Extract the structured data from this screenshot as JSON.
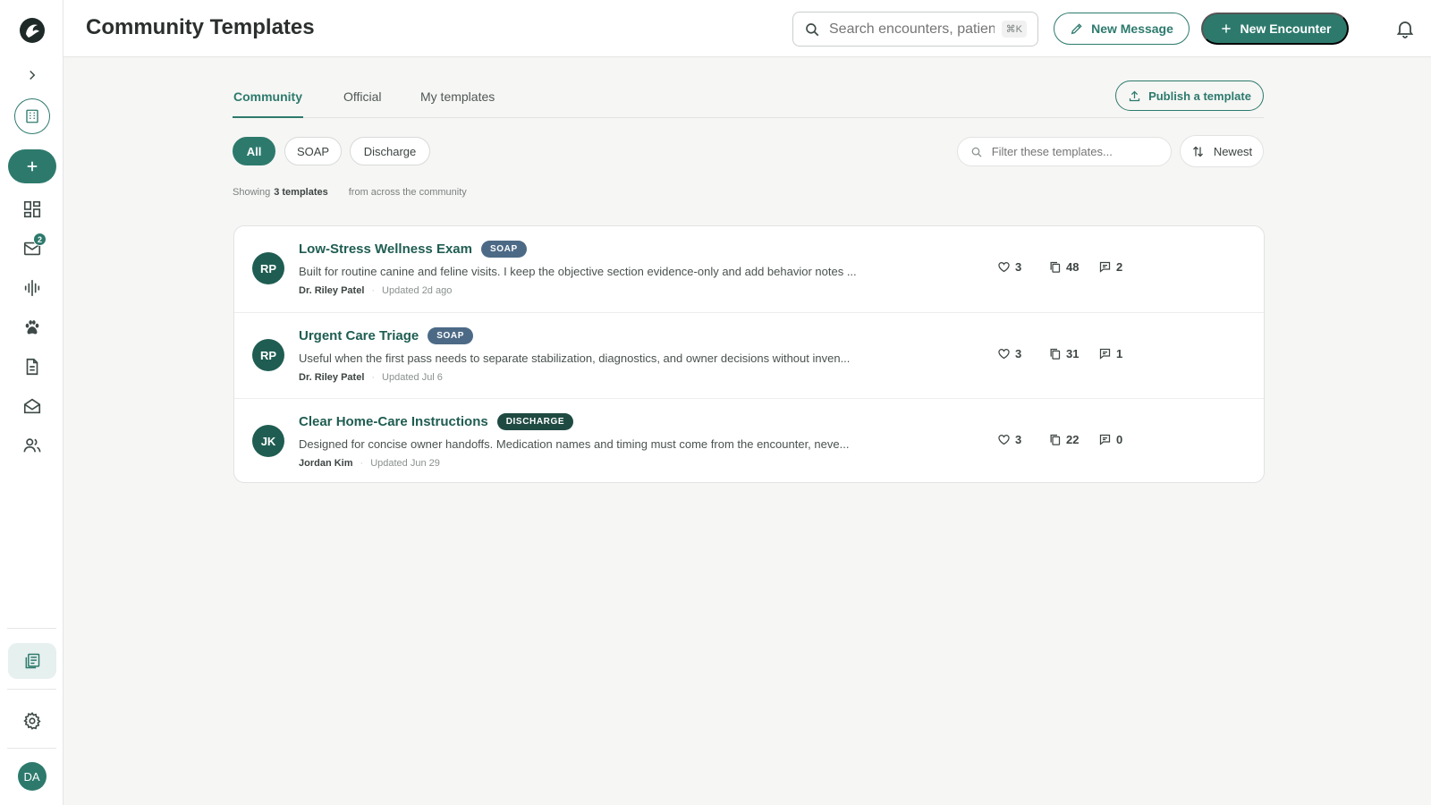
{
  "sidebar": {
    "inbox_badge": "2",
    "user_initials": "DA"
  },
  "header": {
    "title": "Community Templates",
    "search_placeholder": "Search encounters, patients...",
    "search_shortcut": "⌘K",
    "new_message_label": "New Message",
    "new_encounter_label": "New Encounter"
  },
  "tabs": [
    {
      "label": "Community",
      "active": true
    },
    {
      "label": "Official",
      "active": false
    },
    {
      "label": "My templates",
      "active": false
    }
  ],
  "publish_label": "Publish a template",
  "chips": [
    {
      "label": "All",
      "active": true
    },
    {
      "label": "SOAP",
      "active": false
    },
    {
      "label": "Discharge",
      "active": false
    }
  ],
  "filter_placeholder": "Filter these templates...",
  "sort_label": "Newest",
  "showing": {
    "prefix": "Showing",
    "count": "3 templates",
    "suffix": "from across the community"
  },
  "templates": [
    {
      "initials": "RP",
      "title": "Low-Stress Wellness Exam",
      "tag": "SOAP",
      "description": "Built for routine canine and feline visits. I keep the objective section evidence-only and add behavior notes ...",
      "author": "Dr. Riley Patel",
      "updated": "Updated 2d ago",
      "likes": "3",
      "copies": "48",
      "comments": "2"
    },
    {
      "initials": "RP",
      "title": "Urgent Care Triage",
      "tag": "SOAP",
      "description": "Useful when the first pass needs to separate stabilization, diagnostics, and owner decisions without inven...",
      "author": "Dr. Riley Patel",
      "updated": "Updated Jul 6",
      "likes": "3",
      "copies": "31",
      "comments": "1"
    },
    {
      "initials": "JK",
      "title": "Clear Home-Care Instructions",
      "tag": "DISCHARGE",
      "description": "Designed for concise owner handoffs. Medication names and timing must come from the encounter, neve...",
      "author": "Jordan Kim",
      "updated": "Updated Jun 29",
      "likes": "3",
      "copies": "22",
      "comments": "0"
    }
  ],
  "colors": {
    "accent": "#2d7a6d",
    "accent_dark": "#1f5d52",
    "soap_tag": "#4c6a86",
    "discharge_tag": "#1f4a42",
    "background": "#f6f6f4"
  }
}
